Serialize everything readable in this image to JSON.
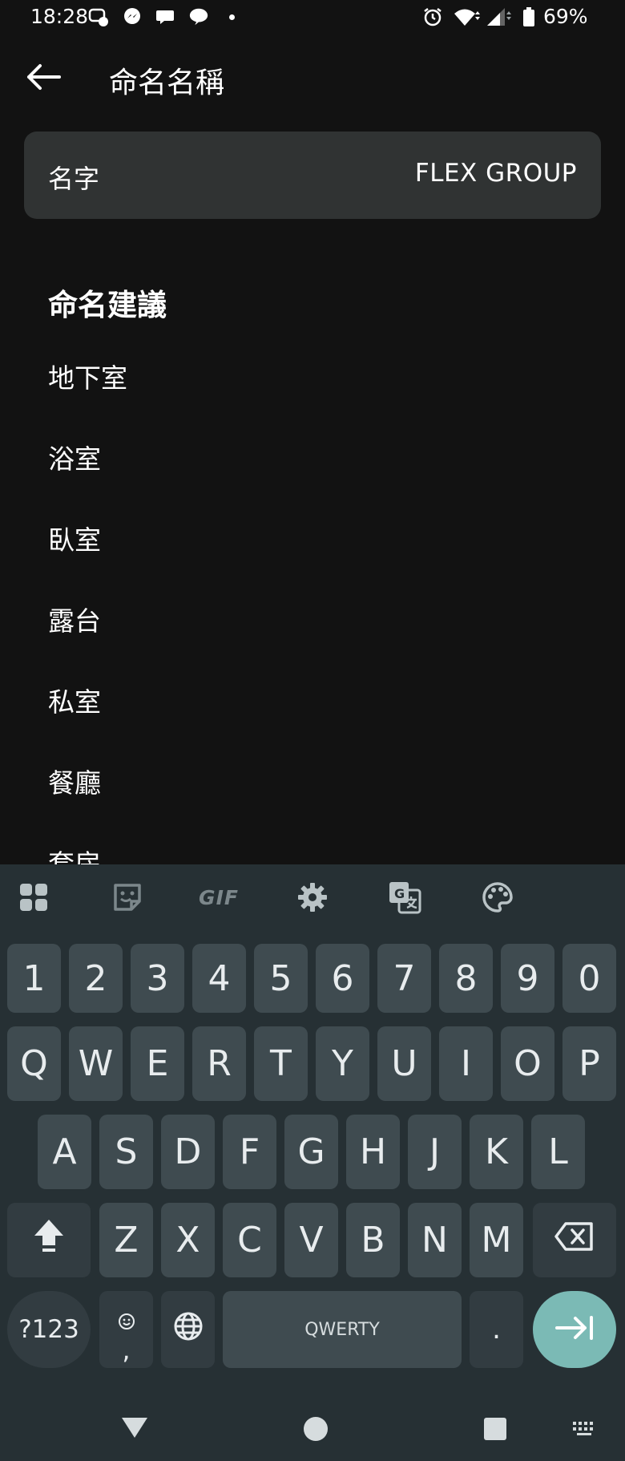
{
  "status_bar": {
    "time": "18:28",
    "battery": "69%",
    "icons": [
      "facebook-messenger-notification-icon",
      "messenger-icon",
      "chat-bubble-icon",
      "line-icon",
      "alarm-icon",
      "wifi-icon",
      "signal-icon",
      "battery-icon"
    ]
  },
  "app_bar": {
    "title": "命名名稱",
    "back_icon": "arrow-back-icon"
  },
  "name_field": {
    "label": "名字",
    "value": "FLEX GROUP"
  },
  "suggestions": {
    "title": "命名建議",
    "items": [
      "地下室",
      "浴室",
      "臥室",
      "露台",
      "私室",
      "餐廳",
      "套房"
    ]
  },
  "keyboard": {
    "toolbar": [
      "apps-grid-icon",
      "sticker-icon",
      "gif-icon",
      "settings-gear-icon",
      "translate-icon",
      "palette-icon"
    ],
    "gif_label": "GIF",
    "row_numbers": [
      "1",
      "2",
      "3",
      "4",
      "5",
      "6",
      "7",
      "8",
      "9",
      "0"
    ],
    "row_1": [
      "Q",
      "W",
      "E",
      "R",
      "T",
      "Y",
      "U",
      "I",
      "O",
      "P"
    ],
    "row_2": [
      "A",
      "S",
      "D",
      "F",
      "G",
      "H",
      "J",
      "K",
      "L"
    ],
    "row_3": [
      "Z",
      "X",
      "C",
      "V",
      "B",
      "N",
      "M"
    ],
    "symbols_label": "?123",
    "comma_label": ",",
    "space_label": "QWERTY",
    "period_label": "."
  },
  "colors": {
    "background": "#121212",
    "card": "#303333",
    "keyboard": "#263034",
    "key": "#3f4b50",
    "enter_key": "#7bbab5"
  }
}
